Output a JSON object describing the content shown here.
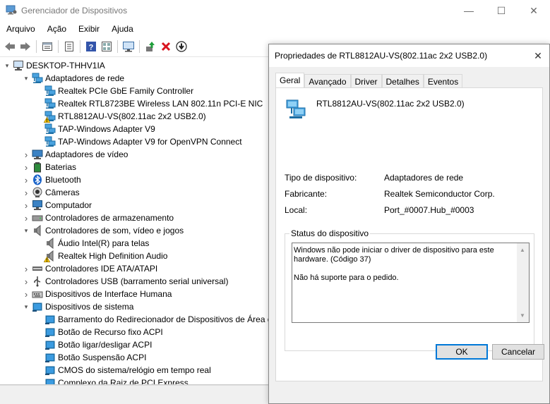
{
  "main_window": {
    "title": "Gerenciador de Dispositivos",
    "controls": {
      "minimize": "—",
      "maximize": "☐",
      "close": "✕"
    }
  },
  "menu": [
    "Arquivo",
    "Ação",
    "Exibir",
    "Ajuda"
  ],
  "toolbar": [
    "back-arrow-icon",
    "forward-arrow-icon",
    "properties-icon",
    "show-hide-icon",
    "help-icon",
    "view-icon",
    "scan-hardware-icon",
    "update-driver-icon",
    "uninstall-icon",
    "download-icon"
  ],
  "tree": {
    "root": "DESKTOP-THHV1IA",
    "items": [
      {
        "label": "Adaptadores de rede",
        "level": 1,
        "state": "expanded",
        "icon": "network-adapter-icon"
      },
      {
        "label": "Realtek PCIe GbE Family Controller",
        "level": 2,
        "icon": "network-adapter-icon"
      },
      {
        "label": "Realtek RTL8723BE Wireless LAN 802.11n PCI-E NIC",
        "level": 2,
        "icon": "network-adapter-icon"
      },
      {
        "label": "RTL8812AU-VS(802.11ac 2x2 USB2.0)",
        "level": 2,
        "icon": "network-adapter-warning-icon"
      },
      {
        "label": "TAP-Windows Adapter V9",
        "level": 2,
        "icon": "network-adapter-icon"
      },
      {
        "label": "TAP-Windows Adapter V9 for OpenVPN Connect",
        "level": 2,
        "icon": "network-adapter-icon"
      },
      {
        "label": "Adaptadores de vídeo",
        "level": 1,
        "state": "collapsed",
        "icon": "display-adapter-icon"
      },
      {
        "label": "Baterias",
        "level": 1,
        "state": "collapsed",
        "icon": "battery-icon"
      },
      {
        "label": "Bluetooth",
        "level": 1,
        "state": "collapsed",
        "icon": "bluetooth-icon"
      },
      {
        "label": "Câmeras",
        "level": 1,
        "state": "collapsed",
        "icon": "camera-icon"
      },
      {
        "label": "Computador",
        "level": 1,
        "state": "collapsed",
        "icon": "computer-icon"
      },
      {
        "label": "Controladores de armazenamento",
        "level": 1,
        "state": "collapsed",
        "icon": "storage-controller-icon"
      },
      {
        "label": "Controladores de som, vídeo e jogos",
        "level": 1,
        "state": "expanded",
        "icon": "speaker-icon"
      },
      {
        "label": "Áudio Intel(R) para telas",
        "level": 2,
        "icon": "speaker-icon"
      },
      {
        "label": "Realtek High Definition Audio",
        "level": 2,
        "icon": "speaker-warning-icon"
      },
      {
        "label": "Controladores IDE ATA/ATAPI",
        "level": 1,
        "state": "collapsed",
        "icon": "ide-controller-icon"
      },
      {
        "label": "Controladores USB (barramento serial universal)",
        "level": 1,
        "state": "collapsed",
        "icon": "usb-icon"
      },
      {
        "label": "Dispositivos de Interface Humana",
        "level": 1,
        "state": "collapsed",
        "icon": "hid-icon"
      },
      {
        "label": "Dispositivos de sistema",
        "level": 1,
        "state": "expanded",
        "icon": "system-device-icon"
      },
      {
        "label": "Barramento do Redirecionador de Dispositivos de Área d",
        "level": 2,
        "icon": "system-device-icon"
      },
      {
        "label": "Botão de Recurso fixo ACPI",
        "level": 2,
        "icon": "system-device-icon"
      },
      {
        "label": "Botão ligar/desligar ACPI",
        "level": 2,
        "icon": "system-device-icon"
      },
      {
        "label": "Botão Suspensão ACPI",
        "level": 2,
        "icon": "system-device-icon"
      },
      {
        "label": "CMOS do sistema/relógio em tempo real",
        "level": 2,
        "icon": "system-device-icon"
      },
      {
        "label": "Complexo da Raiz de PCI Express",
        "level": 2,
        "icon": "system-device-icon"
      }
    ]
  },
  "dialog": {
    "title": "Propriedades de RTL8812AU-VS(802.11ac 2x2 USB2.0)",
    "close": "✕",
    "tabs": [
      "Geral",
      "Avançado",
      "Driver",
      "Detalhes",
      "Eventos"
    ],
    "active_tab": "Geral",
    "device_name": "RTL8812AU-VS(802.11ac 2x2 USB2.0)",
    "properties": [
      {
        "label": "Tipo de dispositivo:",
        "value": "Adaptadores de rede"
      },
      {
        "label": "Fabricante:",
        "value": "Realtek Semiconductor Corp."
      },
      {
        "label": "Local:",
        "value": "Port_#0007.Hub_#0003"
      }
    ],
    "status_title": "Status do dispositivo",
    "status_line1": "Windows não pode iniciar o driver de dispositivo para este hardware. (Código 37)",
    "status_line2": "Não há suporte para o pedido.",
    "ok_label": "OK",
    "cancel_label": "Cancelar"
  }
}
